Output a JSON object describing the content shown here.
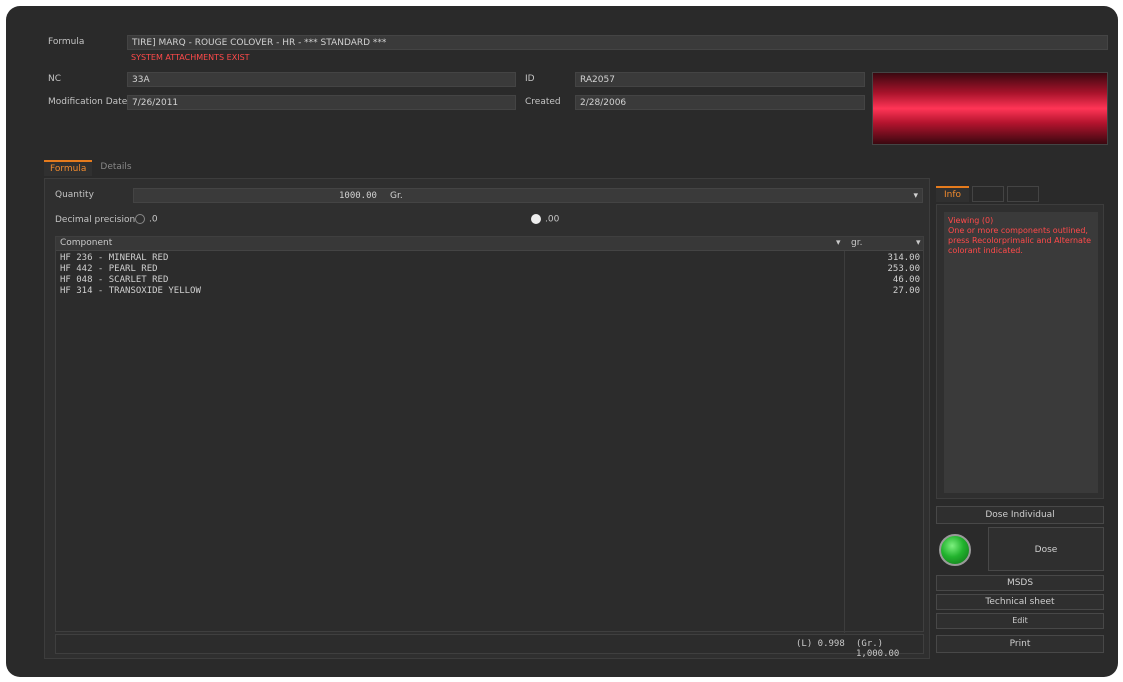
{
  "header": {
    "formula_label": "Formula",
    "formula_value": "TIRE] MARQ - ROUGE COLOVER - HR - *** STANDARD ***",
    "formula_warning": "SYSTEM ATTACHMENTS EXIST",
    "nc_label": "NC",
    "nc_value": "33A",
    "id_label": "ID",
    "id_value": "RA2057",
    "modification_label": "Modification Date",
    "modification_value": "7/26/2011",
    "created_label": "Created",
    "created_value": "2/28/2006",
    "swatch_color": "#e01e3c"
  },
  "tabs": [
    {
      "label": "Formula",
      "active": true
    },
    {
      "label": "Details",
      "active": false
    }
  ],
  "quantity": {
    "label": "Quantity",
    "value": "1000.00",
    "unit": "Gr."
  },
  "precision": {
    "label": "Decimal precision",
    "option_a": ".0",
    "option_b": ".00",
    "selected": "option_b"
  },
  "table": {
    "col_component": "Component",
    "col_unit": "gr.",
    "rows": [
      {
        "name": "HF 236 - MINERAL RED",
        "value": "314.00"
      },
      {
        "name": "HF 442 - PEARL RED",
        "value": "253.00"
      },
      {
        "name": "HF 048 - SCARLET RED",
        "value": "46.00"
      },
      {
        "name": "HF 314 - TRANSOXIDE YELLOW",
        "value": "27.00"
      }
    ],
    "footer_lt": "(L) 0.998",
    "footer_gr": "(Gr.) 1,000.00"
  },
  "side": {
    "tabs": [
      "Info",
      "",
      ""
    ],
    "info_title": "Viewing (0)",
    "info_text": "One or more components outlined, press Recolorprimalic and Alternate colorant indicated."
  },
  "buttons": {
    "dose_individual": "Dose Individual",
    "dose": "Dose",
    "msds": "MSDS",
    "technical_sheet": "Technical sheet",
    "edit": "Edit",
    "print": "Print"
  },
  "colors": {
    "accent_orange": "#e57b1d",
    "warning_red": "#ff4a4a",
    "status_green": "#22b32e"
  }
}
